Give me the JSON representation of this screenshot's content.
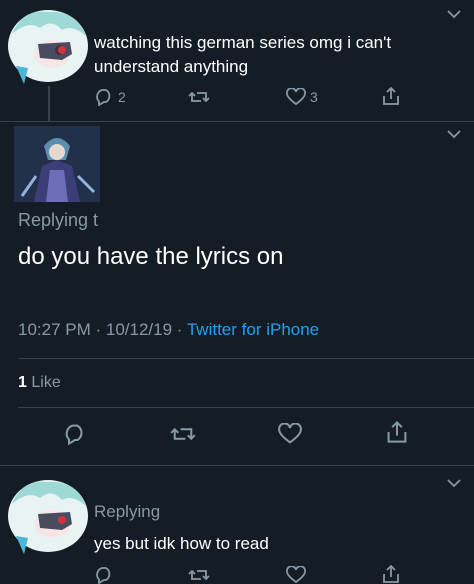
{
  "tweet1": {
    "text": "watching this german series omg i can't understand anything",
    "replies": "2",
    "likes": "3"
  },
  "main": {
    "replying_prefix": "Replying t",
    "text": "do you have the lyrics on",
    "timestamp": "10:27 PM · 10/12/19 · ",
    "source": "Twitter for iPhone",
    "likes_count": "1",
    "likes_label": "Like"
  },
  "tweet3": {
    "replying_prefix": "Replying",
    "text": "yes but idk how to read"
  },
  "colors": {
    "background": "#141d26",
    "secondary_text": "#8899a6",
    "accent": "#1da1f2",
    "divider": "#38444d"
  },
  "icons": [
    "reply-icon",
    "retweet-icon",
    "like-icon",
    "share-icon",
    "chevron-down-icon"
  ]
}
